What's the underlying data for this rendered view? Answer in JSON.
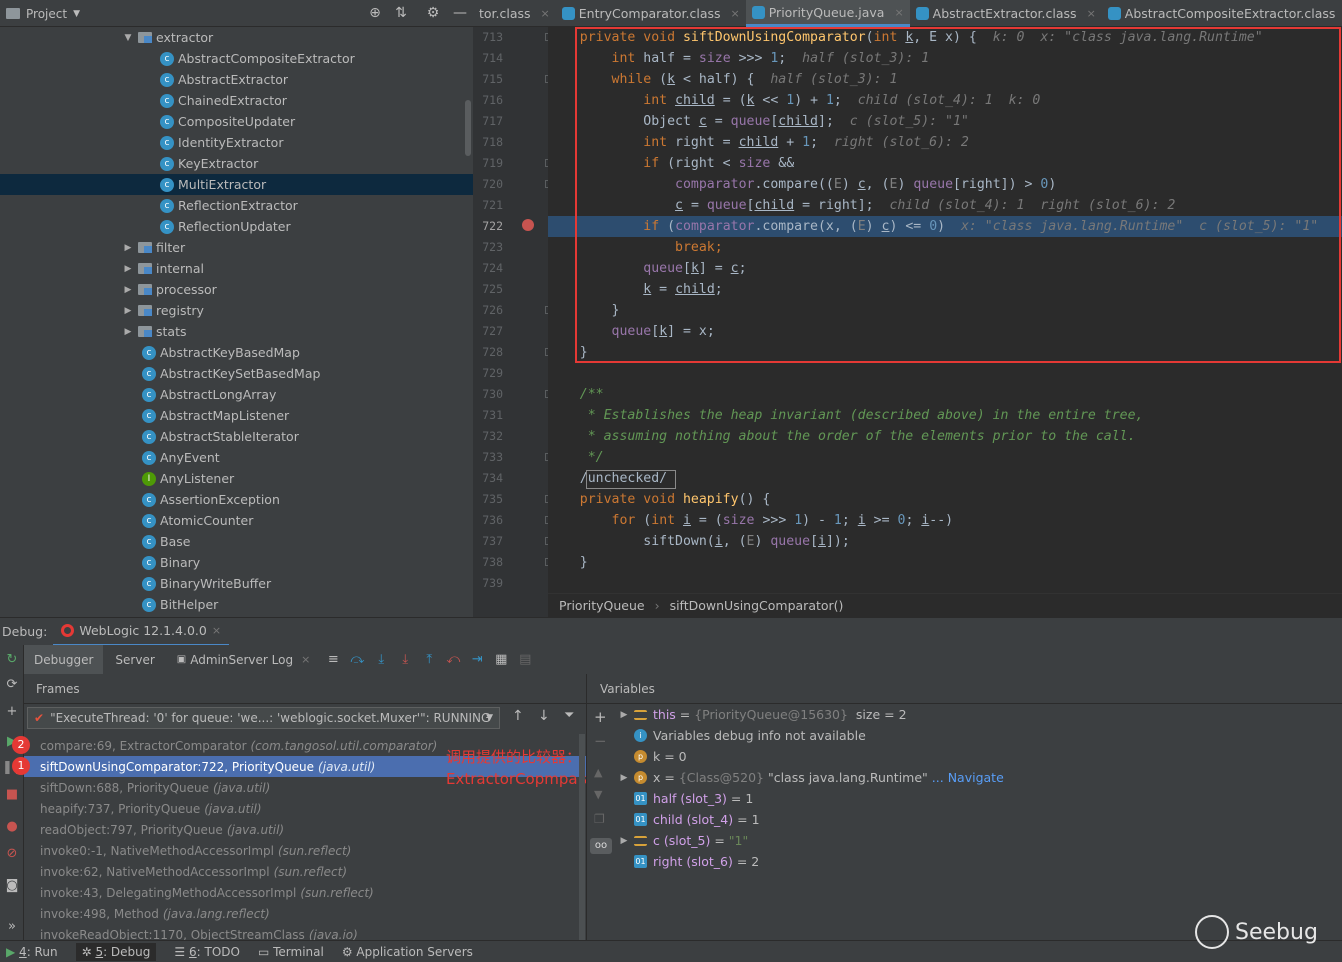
{
  "project_panel": {
    "title": "Project"
  },
  "tabs": [
    {
      "label": "tor.class",
      "active": false
    },
    {
      "label": "EntryComparator.class",
      "active": false
    },
    {
      "label": "PriorityQueue.java",
      "active": true
    },
    {
      "label": "AbstractExtractor.class",
      "active": false
    },
    {
      "label": "AbstractCompositeExtractor.class",
      "active": false
    },
    {
      "label": "Li",
      "active": false
    }
  ],
  "tree": [
    {
      "label": "extractor",
      "type": "folder",
      "indent": 1,
      "expanded": true
    },
    {
      "label": "AbstractCompositeExtractor",
      "type": "class",
      "indent": 2
    },
    {
      "label": "AbstractExtractor",
      "type": "class",
      "indent": 2
    },
    {
      "label": "ChainedExtractor",
      "type": "class",
      "indent": 2
    },
    {
      "label": "CompositeUpdater",
      "type": "class",
      "indent": 2
    },
    {
      "label": "IdentityExtractor",
      "type": "class",
      "indent": 2
    },
    {
      "label": "KeyExtractor",
      "type": "class",
      "indent": 2
    },
    {
      "label": "MultiExtractor",
      "type": "class",
      "indent": 2,
      "selected": true
    },
    {
      "label": "ReflectionExtractor",
      "type": "class",
      "indent": 2
    },
    {
      "label": "ReflectionUpdater",
      "type": "class",
      "indent": 2
    },
    {
      "label": "filter",
      "type": "folder",
      "indent": 1
    },
    {
      "label": "internal",
      "type": "folder",
      "indent": 1
    },
    {
      "label": "processor",
      "type": "folder",
      "indent": 1
    },
    {
      "label": "registry",
      "type": "folder",
      "indent": 1
    },
    {
      "label": "stats",
      "type": "folder",
      "indent": 1
    },
    {
      "label": "AbstractKeyBasedMap",
      "type": "class",
      "indent": 1
    },
    {
      "label": "AbstractKeySetBasedMap",
      "type": "class",
      "indent": 1
    },
    {
      "label": "AbstractLongArray",
      "type": "class",
      "indent": 1
    },
    {
      "label": "AbstractMapListener",
      "type": "class",
      "indent": 1
    },
    {
      "label": "AbstractStableIterator",
      "type": "class",
      "indent": 1
    },
    {
      "label": "AnyEvent",
      "type": "class",
      "indent": 1
    },
    {
      "label": "AnyListener",
      "type": "interface",
      "indent": 1
    },
    {
      "label": "AssertionException",
      "type": "class",
      "indent": 1
    },
    {
      "label": "AtomicCounter",
      "type": "class",
      "indent": 1
    },
    {
      "label": "Base",
      "type": "class",
      "indent": 1
    },
    {
      "label": "Binary",
      "type": "class",
      "indent": 1
    },
    {
      "label": "BinaryWriteBuffer",
      "type": "class",
      "indent": 1
    },
    {
      "label": "BitHelper",
      "type": "class",
      "indent": 1
    }
  ],
  "editor": {
    "line_numbers": [
      "713",
      "714",
      "715",
      "716",
      "717",
      "718",
      "719",
      "720",
      "721",
      "722",
      "723",
      "724",
      "725",
      "726",
      "727",
      "728",
      "729",
      "730",
      "731",
      "732",
      "733",
      "734",
      "735",
      "736",
      "737",
      "738",
      "739"
    ],
    "current_line": "722",
    "lines": [
      [
        {
          "t": "    "
        },
        {
          "t": "private void ",
          "c": "kw"
        },
        {
          "t": "siftDownUsingComparator",
          "c": "fn"
        },
        {
          "t": "("
        },
        {
          "t": "int ",
          "c": "kw"
        },
        {
          "t": "k",
          "c": "ul"
        },
        {
          "t": ", E x) {  "
        },
        {
          "t": "k: 0  x: \"class java.lang.Runtime\"",
          "c": "hint"
        }
      ],
      [
        {
          "t": "        "
        },
        {
          "t": "int ",
          "c": "kw"
        },
        {
          "t": "half = "
        },
        {
          "t": "size",
          "c": "fld"
        },
        {
          "t": " >>> "
        },
        {
          "t": "1",
          "c": "num"
        },
        {
          "t": ";  "
        },
        {
          "t": "half (slot_3): 1",
          "c": "hint"
        }
      ],
      [
        {
          "t": "        "
        },
        {
          "t": "while ",
          "c": "kw"
        },
        {
          "t": "("
        },
        {
          "t": "k",
          "c": "ul"
        },
        {
          "t": " < half) {  "
        },
        {
          "t": "half (slot_3): 1",
          "c": "hint"
        }
      ],
      [
        {
          "t": "            "
        },
        {
          "t": "int ",
          "c": "kw"
        },
        {
          "t": "child",
          "c": "ul"
        },
        {
          "t": " = ("
        },
        {
          "t": "k",
          "c": "ul"
        },
        {
          "t": " << "
        },
        {
          "t": "1",
          "c": "num"
        },
        {
          "t": ") + "
        },
        {
          "t": "1",
          "c": "num"
        },
        {
          "t": ";  "
        },
        {
          "t": "child (slot_4): 1  k: 0",
          "c": "hint"
        }
      ],
      [
        {
          "t": "            Object "
        },
        {
          "t": "c",
          "c": "ul"
        },
        {
          "t": " = "
        },
        {
          "t": "queue",
          "c": "fld"
        },
        {
          "t": "["
        },
        {
          "t": "child",
          "c": "ul"
        },
        {
          "t": "];  "
        },
        {
          "t": "c (slot_5): \"1\"",
          "c": "hint"
        }
      ],
      [
        {
          "t": "            "
        },
        {
          "t": "int ",
          "c": "kw"
        },
        {
          "t": "right = "
        },
        {
          "t": "child",
          "c": "ul"
        },
        {
          "t": " + "
        },
        {
          "t": "1",
          "c": "num"
        },
        {
          "t": ";  "
        },
        {
          "t": "right (slot_6): 2",
          "c": "hint"
        }
      ],
      [
        {
          "t": "            "
        },
        {
          "t": "if ",
          "c": "kw"
        },
        {
          "t": "(right < "
        },
        {
          "t": "size",
          "c": "fld"
        },
        {
          "t": " &&"
        }
      ],
      [
        {
          "t": "                "
        },
        {
          "t": "comparator",
          "c": "fld"
        },
        {
          "t": ".compare(("
        },
        {
          "t": "E",
          "c": "gray"
        },
        {
          "t": ") "
        },
        {
          "t": "c",
          "c": "ul"
        },
        {
          "t": ", ("
        },
        {
          "t": "E",
          "c": "gray"
        },
        {
          "t": ") "
        },
        {
          "t": "queue",
          "c": "fld"
        },
        {
          "t": "[right]) > "
        },
        {
          "t": "0",
          "c": "num"
        },
        {
          "t": ")"
        }
      ],
      [
        {
          "t": "                "
        },
        {
          "t": "c",
          "c": "ul"
        },
        {
          "t": " = "
        },
        {
          "t": "queue",
          "c": "fld"
        },
        {
          "t": "["
        },
        {
          "t": "child",
          "c": "ul"
        },
        {
          "t": " = right];  "
        },
        {
          "t": "child (slot_4): 1  right (slot_6): 2",
          "c": "hint"
        }
      ],
      [
        {
          "t": "            "
        },
        {
          "t": "if ",
          "c": "kw"
        },
        {
          "t": "("
        },
        {
          "t": "comparator",
          "c": "fld"
        },
        {
          "t": ".compare(x, ("
        },
        {
          "t": "E",
          "c": "gray"
        },
        {
          "t": ") "
        },
        {
          "t": "c",
          "c": "ul"
        },
        {
          "t": ") <= "
        },
        {
          "t": "0",
          "c": "num"
        },
        {
          "t": ")  "
        },
        {
          "t": "x: \"class java.lang.Runtime\"  c (slot_5): \"1\"",
          "c": "hint"
        }
      ],
      [
        {
          "t": "                "
        },
        {
          "t": "break",
          "c": "kw"
        },
        {
          "t": ";",
          "c": "kw"
        }
      ],
      [
        {
          "t": "            "
        },
        {
          "t": "queue",
          "c": "fld"
        },
        {
          "t": "["
        },
        {
          "t": "k",
          "c": "ul"
        },
        {
          "t": "] = "
        },
        {
          "t": "c",
          "c": "ul"
        },
        {
          "t": ";"
        }
      ],
      [
        {
          "t": "            "
        },
        {
          "t": "k",
          "c": "ul"
        },
        {
          "t": " = "
        },
        {
          "t": "child",
          "c": "ul"
        },
        {
          "t": ";"
        }
      ],
      [
        {
          "t": "        }"
        }
      ],
      [
        {
          "t": "        "
        },
        {
          "t": "queue",
          "c": "fld"
        },
        {
          "t": "["
        },
        {
          "t": "k",
          "c": "ul"
        },
        {
          "t": "] = x;"
        }
      ],
      [
        {
          "t": "    }"
        }
      ],
      [
        {
          "t": ""
        }
      ],
      [
        {
          "t": "    "
        },
        {
          "t": "/**",
          "c": "cm"
        }
      ],
      [
        {
          "t": "     "
        },
        {
          "t": "* Establishes the heap invariant (described above) in the entire tree,",
          "c": "cm"
        }
      ],
      [
        {
          "t": "     "
        },
        {
          "t": "* assuming nothing about the order of the elements prior to the call.",
          "c": "cm"
        }
      ],
      [
        {
          "t": "     "
        },
        {
          "t": "*/",
          "c": "cm"
        }
      ],
      [
        {
          "t": "    /unchecked/",
          "c": "box"
        }
      ],
      [
        {
          "t": "    "
        },
        {
          "t": "private void ",
          "c": "kw"
        },
        {
          "t": "heapify",
          "c": "fn"
        },
        {
          "t": "() {"
        }
      ],
      [
        {
          "t": "        "
        },
        {
          "t": "for ",
          "c": "kw"
        },
        {
          "t": "("
        },
        {
          "t": "int ",
          "c": "kw"
        },
        {
          "t": "i",
          "c": "ul"
        },
        {
          "t": " = ("
        },
        {
          "t": "size",
          "c": "fld"
        },
        {
          "t": " >>> "
        },
        {
          "t": "1",
          "c": "num"
        },
        {
          "t": ") - "
        },
        {
          "t": "1",
          "c": "num"
        },
        {
          "t": "; "
        },
        {
          "t": "i",
          "c": "ul"
        },
        {
          "t": " >= "
        },
        {
          "t": "0",
          "c": "num"
        },
        {
          "t": "; "
        },
        {
          "t": "i",
          "c": "ul"
        },
        {
          "t": "--)"
        }
      ],
      [
        {
          "t": "            siftDown("
        },
        {
          "t": "i",
          "c": "ul"
        },
        {
          "t": ", ("
        },
        {
          "t": "E",
          "c": "gray"
        },
        {
          "t": ") "
        },
        {
          "t": "queue",
          "c": "fld"
        },
        {
          "t": "["
        },
        {
          "t": "i",
          "c": "ul"
        },
        {
          "t": "]);"
        }
      ],
      [
        {
          "t": "    }"
        }
      ],
      [
        {
          "t": ""
        }
      ]
    ],
    "breadcrumb": [
      "PriorityQueue",
      "siftDownUsingComparator()"
    ]
  },
  "debug": {
    "label": "Debug:",
    "config": "WebLogic 12.1.4.0.0",
    "tabs": [
      "Debugger",
      "Server",
      "AdminServer Log"
    ],
    "frames_title": "Frames",
    "variables_title": "Variables",
    "thread": "\"ExecuteThread: '0' for queue: 'we...: 'weblogic.socket.Muxer'\": RUNNING",
    "frames": [
      {
        "method": "compare:69, ExtractorComparator",
        "pkg": "(com.tangosol.util.comparator)",
        "badge": "2"
      },
      {
        "method": "siftDownUsingComparator:722, PriorityQueue",
        "pkg": "(java.util)",
        "badge": "1",
        "selected": true
      },
      {
        "method": "siftDown:688, PriorityQueue",
        "pkg": "(java.util)"
      },
      {
        "method": "heapify:737, PriorityQueue",
        "pkg": "(java.util)"
      },
      {
        "method": "readObject:797, PriorityQueue",
        "pkg": "(java.util)"
      },
      {
        "method": "invoke0:-1, NativeMethodAccessorImpl",
        "pkg": "(sun.reflect)"
      },
      {
        "method": "invoke:62, NativeMethodAccessorImpl",
        "pkg": "(sun.reflect)"
      },
      {
        "method": "invoke:43, DelegatingMethodAccessorImpl",
        "pkg": "(sun.reflect)"
      },
      {
        "method": "invoke:498, Method",
        "pkg": "(java.lang.reflect)"
      },
      {
        "method": "invokeReadObject:1170, ObjectStreamClass",
        "pkg": "(java.io)"
      }
    ],
    "annotation": "调用提供的比较器：ExtractorCopmparator",
    "variables": [
      {
        "icon": "obj",
        "expand": true,
        "name": "this",
        "eq": " = ",
        "type": "{PriorityQueue@15630}",
        "val": "  size = 2"
      },
      {
        "icon": "info",
        "name": "Variables debug info not available",
        "plain": true
      },
      {
        "icon": "p",
        "name": "k",
        "eq": " = ",
        "val": "0",
        "plainname": true
      },
      {
        "icon": "p",
        "expand": true,
        "name": "x",
        "eq": " = ",
        "type": "{Class@520}",
        "str": " \"class java.lang.Runtime\"",
        "link": "... Navigate",
        "plainname": true
      },
      {
        "icon": "o",
        "name": "half (slot_3)",
        "eq": " = ",
        "val": "1"
      },
      {
        "icon": "o",
        "name": "child (slot_4)",
        "eq": " = ",
        "val": "1"
      },
      {
        "icon": "obj",
        "expand": true,
        "name": "c (slot_5)",
        "eq": " = ",
        "str": "\"1\""
      },
      {
        "icon": "o",
        "name": "right (slot_6)",
        "eq": " = ",
        "val": "2"
      }
    ]
  },
  "statusbar": [
    {
      "num": "4",
      "label": ": Run"
    },
    {
      "num": "5",
      "label": ": Debug",
      "active": true
    },
    {
      "num": "6",
      "label": ": TODO"
    },
    {
      "num": "",
      "label": "Terminal"
    },
    {
      "num": "",
      "label": "Application Servers"
    }
  ],
  "watermark": "Seebug"
}
